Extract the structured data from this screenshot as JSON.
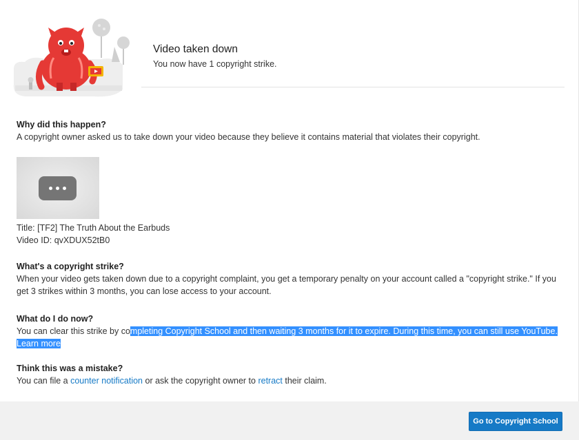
{
  "header": {
    "title": "Video taken down",
    "subtitle": "You now have 1 copyright strike.",
    "illustration": "red-monster-illustration"
  },
  "why": {
    "title": "Why did this happen?",
    "body": "A copyright owner asked us to take down your video because they believe it contains material that violates their copyright."
  },
  "video": {
    "thumbnail_icon": "ellipsis-icon",
    "title_label": "Title:",
    "title": "[TF2] The Truth About the Earbuds",
    "id_label": "Video ID:",
    "id": "qvXDUX52tB0"
  },
  "strike": {
    "title": "What's a copyright strike?",
    "body": "When your video gets taken down due to a copyright complaint, you get a temporary penalty on your account called a \"copyright strike.\" If you get 3 strikes within 3 months, you can lose access to your account."
  },
  "todo": {
    "title": "What do I do now?",
    "body_plain": "You can clear this strike by co",
    "body_highlighted": "mpleting Copyright School and then waiting 3 months for it to expire. During this time, you can still use YouTube.",
    "learn_more": "Learn more"
  },
  "mistake": {
    "title": "Think this was a mistake?",
    "prefix": "You can file a ",
    "counter_link": "counter notification",
    "middle": " or ask the copyright owner to ",
    "retract_link": "retract",
    "suffix": " their claim."
  },
  "footer": {
    "button_label": "Go to Copyright School"
  },
  "colors": {
    "accent": "#167ac6",
    "selection": "#3390ff",
    "footer_bg": "#f1f1f1",
    "monster_red": "#e53935"
  }
}
